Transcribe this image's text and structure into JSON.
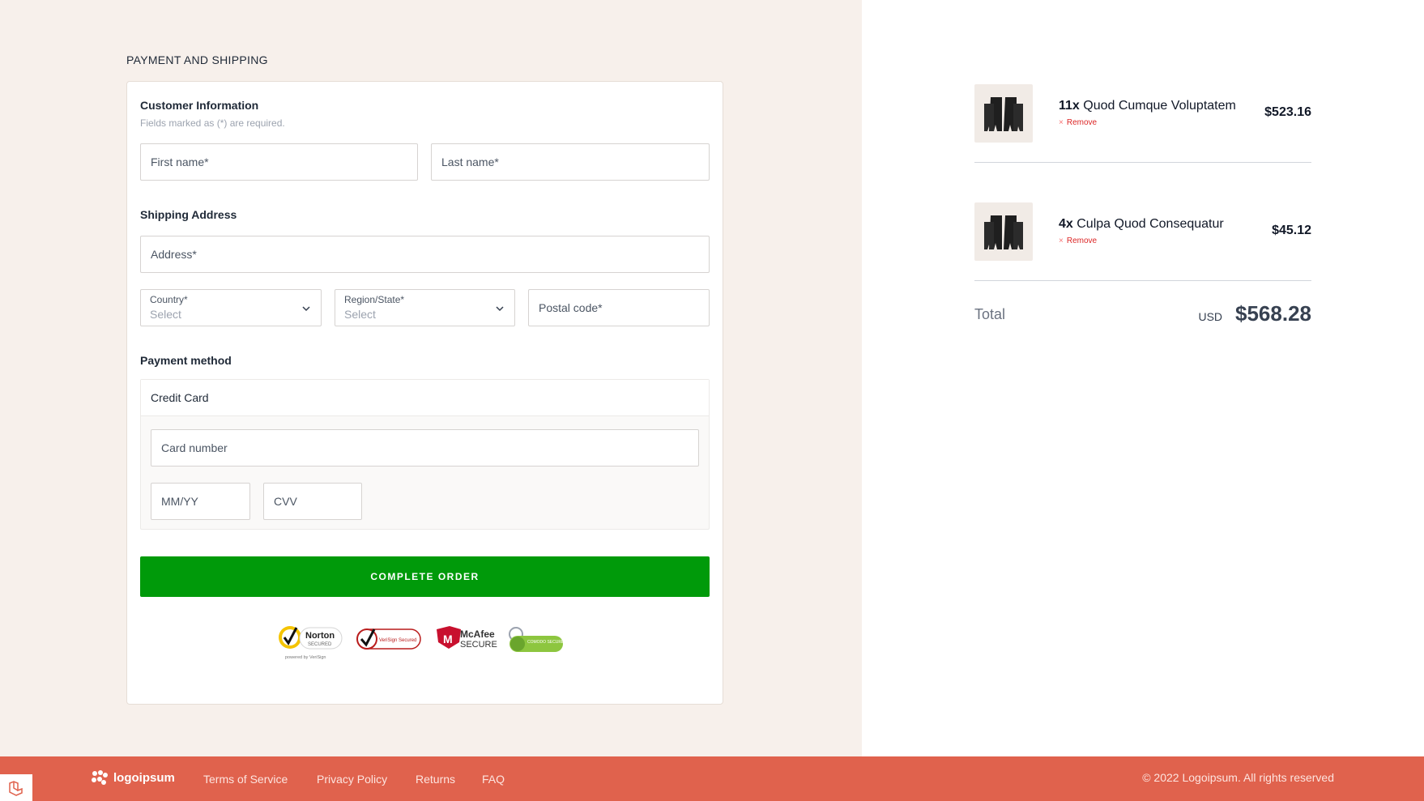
{
  "page": {
    "section_title": "PAYMENT AND SHIPPING"
  },
  "customer": {
    "heading": "Customer Information",
    "hint": "Fields marked as (*) are required.",
    "first_name_placeholder": "First name*",
    "last_name_placeholder": "Last name*"
  },
  "shipping": {
    "heading": "Shipping Address",
    "address_placeholder": "Address*",
    "country_label": "Country*",
    "country_value": "Select",
    "region_label": "Region/State*",
    "region_value": "Select",
    "postal_placeholder": "Postal code*"
  },
  "payment": {
    "heading": "Payment method",
    "method": "Credit Card",
    "card_number_placeholder": "Card number",
    "expiry_placeholder": "MM/YY",
    "cvv_placeholder": "CVV"
  },
  "actions": {
    "complete_label": "COMPLETE ORDER"
  },
  "badges": {
    "norton": "Norton",
    "norton_sub": "SECURED",
    "norton_powered": "powered by VeriSign",
    "verisign": "VeriSign Secured",
    "mcafee": "McAfee",
    "mcafee_sub": "SECURE",
    "comodo": "COMODO SECURE"
  },
  "order": {
    "items": [
      {
        "qty": "11x",
        "name": "Quod Cumque Voluptatem",
        "remove": "Remove",
        "price": "$523.16"
      },
      {
        "qty": "4x",
        "name": "Culpa Quod Consequatur",
        "remove": "Remove",
        "price": "$45.12"
      }
    ],
    "total_label": "Total",
    "currency": "USD",
    "total": "$568.28"
  },
  "footer": {
    "logo_text": "logoipsum",
    "links": [
      "Terms of Service",
      "Privacy Policy",
      "Returns",
      "FAQ"
    ],
    "copyright": "© 2022 Logoipsum. All rights reserved"
  },
  "colors": {
    "left_bg": "#f7f0eb",
    "accent_green": "#009a0a",
    "footer_bg": "#e0624d",
    "remove_red": "#dc2626"
  },
  "icons": [
    "chevron-down-icon",
    "remove-x-icon",
    "logoipsum-logo-icon",
    "laravel-icon",
    "norton-badge-icon",
    "verisign-badge-icon",
    "mcafee-badge-icon",
    "comodo-badge-icon"
  ]
}
